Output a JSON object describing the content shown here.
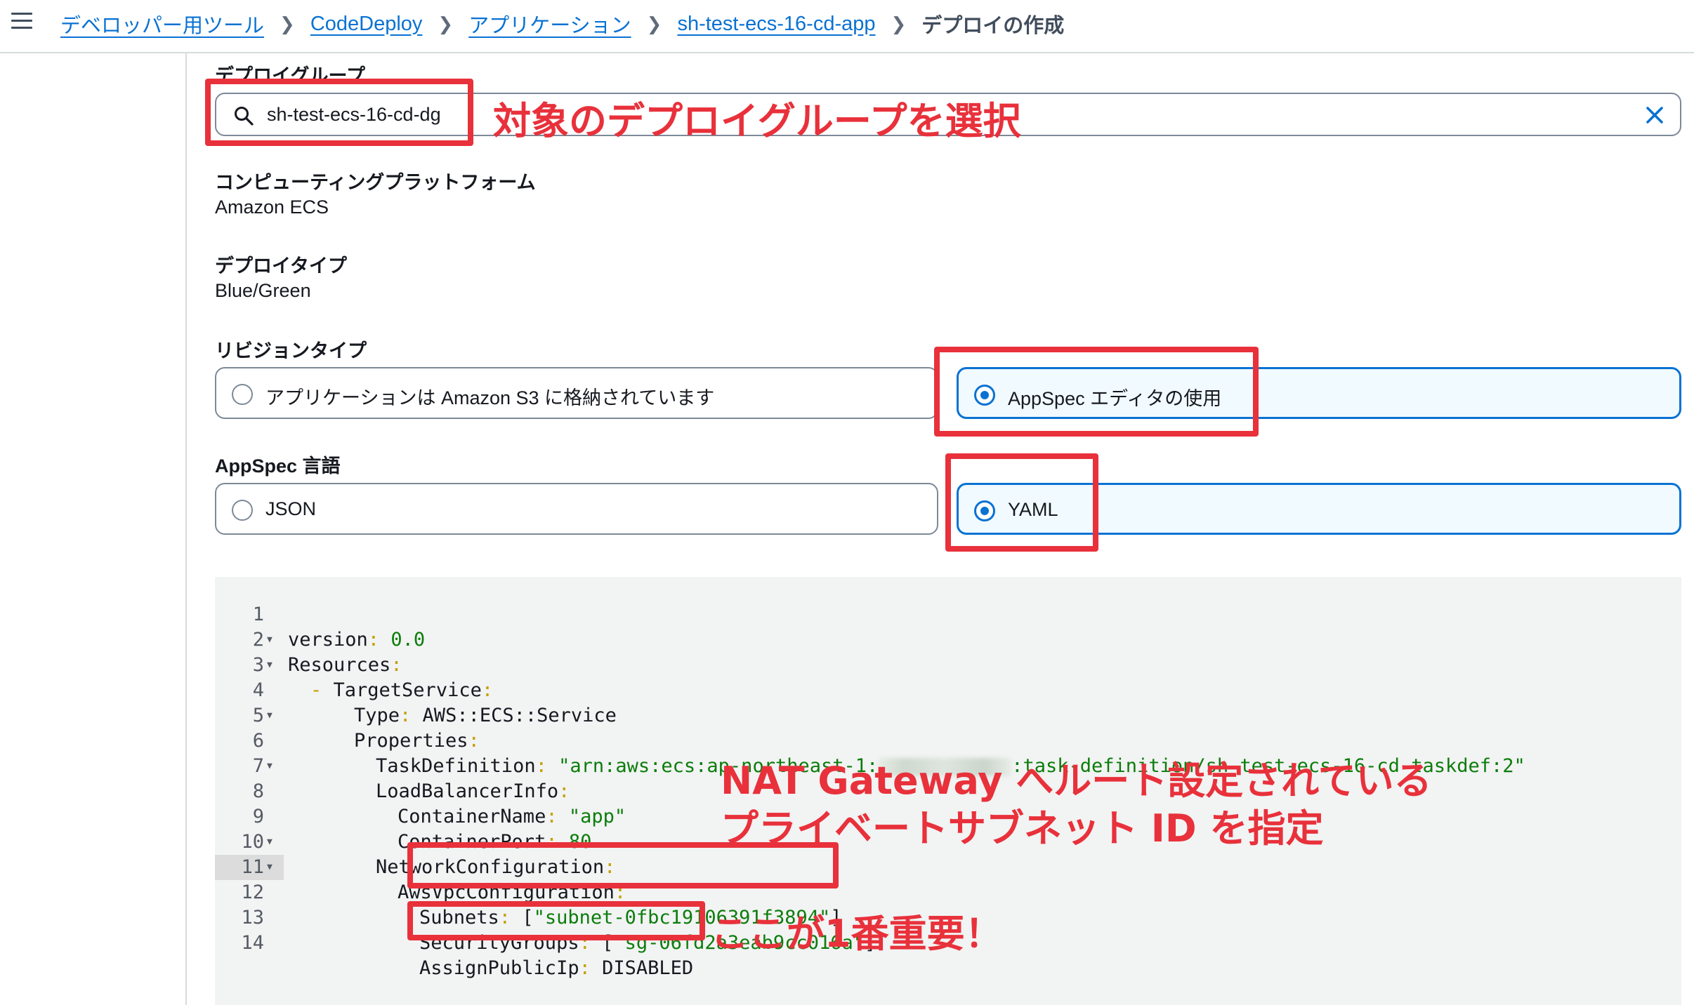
{
  "breadcrumb": {
    "items": [
      "デベロッパー用ツール",
      "CodeDeploy",
      "アプリケーション",
      "sh-test-ecs-16-cd-app"
    ],
    "current": "デプロイの作成"
  },
  "deployment_group": {
    "label": "デプロイグループ",
    "value": "sh-test-ecs-16-cd-dg"
  },
  "compute_platform": {
    "label": "コンピューティングプラットフォーム",
    "value": "Amazon ECS"
  },
  "deploy_type": {
    "label": "デプロイタイプ",
    "value": "Blue/Green"
  },
  "revision_type": {
    "label": "リビジョンタイプ",
    "options": [
      "アプリケーションは Amazon S3 に格納されています",
      "AppSpec エディタの使用"
    ],
    "selected": "AppSpec エディタの使用"
  },
  "appspec_language": {
    "label": "AppSpec 言語",
    "options": [
      "JSON",
      "YAML"
    ],
    "selected": "YAML"
  },
  "editor": {
    "highlighted_line": 12,
    "line_numbers": [
      "1",
      "2",
      "3",
      "4",
      "5",
      "6",
      "7",
      "8",
      "9",
      "10",
      "11",
      "12",
      "13",
      "14"
    ],
    "lines": {
      "l1": {
        "k": "version",
        "p": ":",
        "v": " 0.0"
      },
      "l2": {
        "k": "Resources",
        "p": ":"
      },
      "l3": {
        "d": "- ",
        "k": "TargetService",
        "p": ":"
      },
      "l4": {
        "k": "Type",
        "p": ":",
        "v": " AWS::ECS::Service"
      },
      "l5": {
        "k": "Properties",
        "p": ":"
      },
      "l6": {
        "k": "TaskDefinition",
        "p": ":",
        "v1": " \"arn:aws:ecs:ap-northeast-1:",
        "v2": ":task-definition/sh-test-ecs-16-cd-taskdef:2\""
      },
      "l7": {
        "k": "LoadBalancerInfo",
        "p": ":"
      },
      "l8": {
        "k": "ContainerName",
        "p": ":",
        "v": " \"app\""
      },
      "l9": {
        "k": "ContainerPort",
        "p": ":",
        "v": " 80"
      },
      "l10": {
        "k": "NetworkConfiguration",
        "p": ":"
      },
      "l11": {
        "k": "AwsVpcConfiguration",
        "p": ":"
      },
      "l12": {
        "k": "Subnets",
        "p": ":",
        "b1": " [",
        "v": "\"subnet-0fbc19106391f3894\"",
        "b2": "]"
      },
      "l13": {
        "k": "SecurityGroups",
        "p": ":",
        "b1": " [",
        "v": "\"sg-06fd2a3eab9cc016a\"",
        "b2": "]"
      },
      "l14": {
        "k": "AssignPublicIp",
        "p": ":",
        "v": " DISABLED"
      }
    }
  },
  "annotations": {
    "select_group": "対象のデプロイグループを選択",
    "subnet_line1": "NAT Gateway へルート設定されている",
    "subnet_line2": "プライベートサブネット ID を指定",
    "important": "ここが1番重要！"
  },
  "colors": {
    "link": "#0972d3",
    "selected_border": "#0972d3",
    "annotation_red": "#e8313b",
    "code_string": "#0b7d0b",
    "code_punct": "#c5a000"
  },
  "icons": {
    "menu": "hamburger-icon",
    "search": "search-icon",
    "clear": "close-icon",
    "separator": "chevron-right-icon"
  }
}
